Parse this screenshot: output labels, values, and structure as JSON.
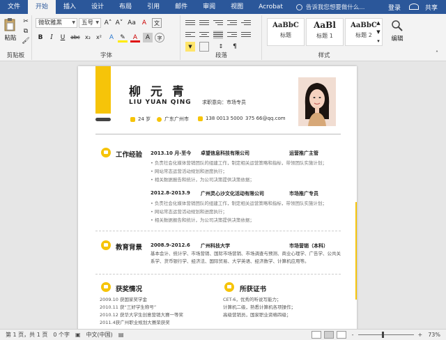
{
  "tabs": [
    "文件",
    "开始",
    "插入",
    "设计",
    "布局",
    "引用",
    "邮件",
    "审阅",
    "视图",
    "Acrobat"
  ],
  "active_tab": "开始",
  "tellme_placeholder": "告诉我您想要做什么...",
  "login": "登录",
  "share": "共享",
  "ribbon": {
    "clipboard": {
      "paste": "粘贴",
      "group": "剪贴板"
    },
    "font": {
      "name": "微软雅黑",
      "size": "五号",
      "group": "字体",
      "bold": "B",
      "italic": "I",
      "underline": "U",
      "strike": "abc",
      "sub": "x₂",
      "sup": "x²",
      "grow": "A˄",
      "shrink": "A˅",
      "case": "Aa",
      "clear": "A"
    },
    "paragraph": {
      "group": "段落"
    },
    "styles": {
      "group": "样式",
      "items": [
        {
          "sample": "AaBbC",
          "name": "标题"
        },
        {
          "sample": "AaBl",
          "name": "标题 1"
        },
        {
          "sample": "AaBbC",
          "name": "标题 2"
        }
      ]
    },
    "editing": {
      "label": "编辑"
    }
  },
  "resume": {
    "name": "柳 元 青",
    "pinyin": "LIU YUAN QING",
    "job_label": "求职意向：市场专员",
    "age": "24 岁",
    "city": "广东广州市",
    "phone": "138 0013 5000",
    "email": "375 66@qq.com",
    "work": {
      "title": "工作经验",
      "jobs": [
        {
          "date": "2013.10 月-至今",
          "company": "卓望信息科技有限公司",
          "role": "运营推广主管",
          "bullets": [
            "负责社会化媒体营销团队的组建工作，制定相关运营策略和指标，带领团队实施计划；",
            "网站常态运营活动规划和进度执行；",
            "相关数据报告和统计，为公司决策提供决策依据；"
          ]
        },
        {
          "date": "2012.8-2013.9",
          "company": "广州灵心沙文化活动有限公司",
          "role": "市场推广专员",
          "bullets": [
            "负责社会化媒体营销团队的组建工作，制定相关运营策略和指标，带领团队实施计划；",
            "网站常态运营活动规划和进度执行；",
            "相关数据报告和统计，为公司决策提供决策依据；"
          ]
        }
      ]
    },
    "edu": {
      "title": "教育背景",
      "date": "2008.9-2012.6",
      "school": "广州科技大学",
      "major": "市场营销（本科）",
      "desc": "基本会计、统计学、市场营销、国际市场营销、市场调查与预测、商业心理学、广告学、公共关系学、货币银行学、经济法、国际贸易、大学英语、经济数学、计算机应用等。"
    },
    "awards": {
      "title": "获奖情况",
      "items": [
        "2009.10 获国家奖学金",
        "2010.11 获“三好学生称号”",
        "2010.12 获华大学生创意营销大赛一等奖",
        "2011.4获广州职业规划大赛荣获奖"
      ]
    },
    "certs": {
      "title": "所获证书",
      "items": [
        "CET-6，优秀的听说写能力；",
        "计算机二级，熟悉计算机各项操作；",
        "高级营销员，国家职业资格四级；"
      ]
    }
  },
  "status": {
    "page": "第 1 页，共 1 页",
    "words": "0 个字",
    "lang": "中文(中国)",
    "zoom": "73%",
    "minus": "-",
    "plus": "+"
  }
}
